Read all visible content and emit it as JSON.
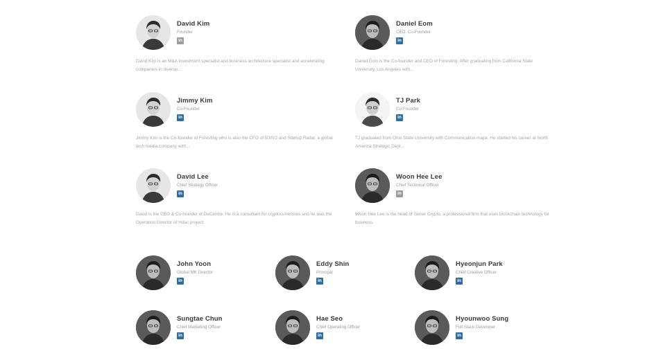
{
  "founders": [
    {
      "name": "David Kim",
      "role": "Founder",
      "linkedin_icon": "in",
      "linkedin_color": "#9b9b9b",
      "photo": "person-photo",
      "bio": "David Kim is an M&A investment specialist and business architecture specialist and accelerating companies in diverse..."
    },
    {
      "name": "Daniel Eom",
      "role": "CEO, Co-Founder",
      "linkedin_icon": "in",
      "linkedin_color": "#2e6da4",
      "photo": "person-photo",
      "bio": "Daniel Eom is the Co-founder and CEO of Foresting. After graduating from California State University, Los Angeles with..."
    },
    {
      "name": "Jimmy Kim",
      "role": "Co-Founder",
      "linkedin_icon": "in",
      "linkedin_color": "#2e6da4",
      "photo": "person-photo",
      "bio": "Jimmy Kim is the Co-founder of Foresting who is also the CFO of 500V2 and Startup Radar, a global tech media company with..."
    },
    {
      "name": "TJ Park",
      "role": "Co-Founder",
      "linkedin_icon": "in",
      "linkedin_color": "#2e6da4",
      "photo": "person-photo",
      "bio": "TJ graduated from Ohio State University with Communication major. He started his career at North America Strategic Dept..."
    },
    {
      "name": "David Lee",
      "role": "Chief Strategy Officer",
      "linkedin_icon": "in",
      "linkedin_color": "#2e6da4",
      "photo": "person-photo",
      "bio": "David is the CEO & Co-founder of DeCentre. He is a consultant for cryptocurrencies and he was the Operation Director of Hdac project."
    },
    {
      "name": "Woon Hee Lee",
      "role": "Chief Technical Officer",
      "linkedin_icon": "in",
      "linkedin_color": "#9b9b9b",
      "photo": "person-photo",
      "bio": "Woon Hee Lee is the head of Gener Crypto, a professional firm that uses blockchain technology for business."
    }
  ],
  "team": [
    {
      "name": "John Yoon",
      "role": "Global MK Director",
      "linkedin_icon": "in",
      "linkedin_color": "#2e6da4",
      "photo": "person-photo"
    },
    {
      "name": "Eddy Shin",
      "role": "Principal",
      "linkedin_icon": "in",
      "linkedin_color": "#2e6da4",
      "photo": "person-photo"
    },
    {
      "name": "Hyeonjun Park",
      "role": "Chief Creative Officer",
      "linkedin_icon": "in",
      "linkedin_color": "#2e6da4",
      "photo": "person-photo"
    },
    {
      "name": "Sungtae Chun",
      "role": "Chief Marketing Officer",
      "linkedin_icon": "in",
      "linkedin_color": "#2e6da4",
      "photo": "person-photo"
    },
    {
      "name": "Hae Seo",
      "role": "Chief Operating Officer",
      "linkedin_icon": "in",
      "linkedin_color": "#2e6da4",
      "photo": "person-photo"
    },
    {
      "name": "Hyounwoo Sung",
      "role": "Full Stack Developer",
      "linkedin_icon": "in",
      "linkedin_color": "#2e6da4",
      "photo": "person-photo"
    }
  ]
}
